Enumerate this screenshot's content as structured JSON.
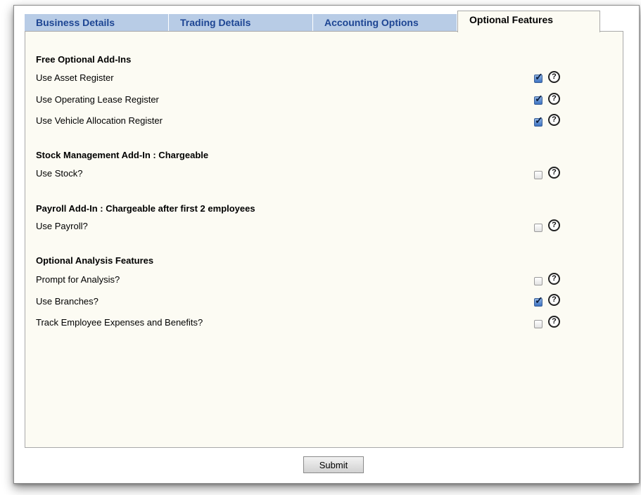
{
  "tabs": [
    {
      "label": "Business Details"
    },
    {
      "label": "Trading Details"
    },
    {
      "label": "Accounting Options"
    },
    {
      "label": "Optional Features"
    }
  ],
  "sections": [
    {
      "title": "Free Optional Add-Ins",
      "items": [
        {
          "label": "Use Asset Register",
          "checked": true
        },
        {
          "label": "Use Operating Lease Register",
          "checked": true
        },
        {
          "label": "Use Vehicle Allocation Register",
          "checked": true
        }
      ]
    },
    {
      "title": "Stock Management Add-In : Chargeable",
      "items": [
        {
          "label": "Use Stock?",
          "checked": false
        }
      ]
    },
    {
      "title": "Payroll Add-In : Chargeable after first 2 employees",
      "items": [
        {
          "label": "Use Payroll?",
          "checked": false
        }
      ]
    },
    {
      "title": "Optional Analysis Features",
      "items": [
        {
          "label": "Prompt for Analysis?",
          "checked": false
        },
        {
          "label": "Use Branches?",
          "checked": true
        },
        {
          "label": "Track Employee Expenses and Benefits?",
          "checked": false
        }
      ]
    }
  ],
  "help_glyph": "?",
  "check_glyph": "✓",
  "submit_label": "Submit",
  "colors": {
    "tab_bg": "#b8cce6",
    "tab_text": "#1d4593",
    "panel_bg": "#fcfbf3",
    "checkbox_checked": "#3c72c2"
  }
}
